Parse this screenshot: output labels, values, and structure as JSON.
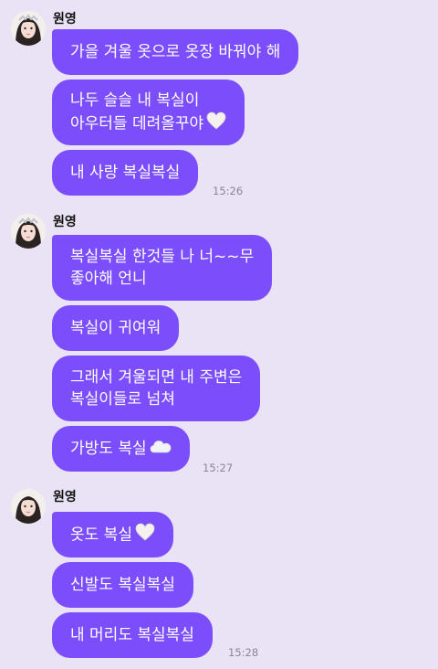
{
  "groups": [
    {
      "sender": "원영",
      "messages": [
        {
          "text": "가을 겨울 옷으로 옷장 바꿔야 해",
          "emoji": ""
        },
        {
          "text": "나두 슬슬 내 복실이\n아우터들 데려올꾸야",
          "emoji": "white-heart"
        },
        {
          "text": "내 사랑 복실복실",
          "emoji": ""
        }
      ],
      "time": "15:26"
    },
    {
      "sender": "원영",
      "messages": [
        {
          "text": "복실복실 한것들 나 너~~무\n좋아해 언니",
          "emoji": ""
        },
        {
          "text": "복실이 귀여워",
          "emoji": ""
        },
        {
          "text": "그래서 겨울되면 내 주변은\n복실이들로 넘쳐",
          "emoji": ""
        },
        {
          "text": "가방도 복실",
          "emoji": "cloud"
        }
      ],
      "time": "15:27"
    },
    {
      "sender": "원영",
      "messages": [
        {
          "text": "옷도 복실",
          "emoji": "white-heart"
        },
        {
          "text": "신발도 복실복실",
          "emoji": ""
        },
        {
          "text": "내 머리도 복실복실",
          "emoji": ""
        }
      ],
      "time": "15:28"
    }
  ],
  "colors": {
    "background": "#e9e3f5",
    "bubble": "#7c4dfb",
    "bubble_text": "#ffffff",
    "sender_text": "#111111",
    "time_text": "#8a8693"
  }
}
